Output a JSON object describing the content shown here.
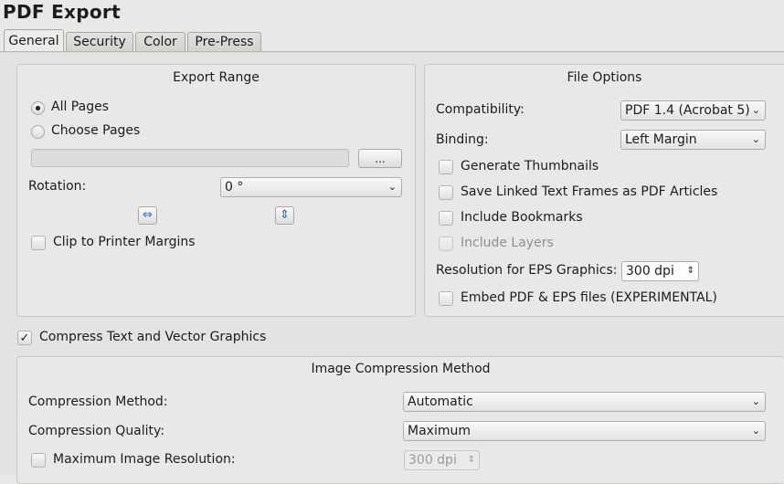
{
  "window": {
    "title": "PDF Export"
  },
  "tabs": [
    {
      "label": "General"
    },
    {
      "label": "Security"
    },
    {
      "label": "Color"
    },
    {
      "label": "Pre-Press"
    }
  ],
  "export_range": {
    "title": "Export Range",
    "all_pages": "All Pages",
    "choose_pages": "Choose Pages",
    "pages_value": "",
    "browse_label": "...",
    "rotation_label": "Rotation:",
    "rotation_value": "0 °",
    "clip_label": "Clip to Printer Margins"
  },
  "file_options": {
    "title": "File Options",
    "compatibility_label": "Compatibility:",
    "compatibility_value": "PDF 1.4 (Acrobat 5)",
    "binding_label": "Binding:",
    "binding_value": "Left Margin",
    "generate_thumbnails": "Generate Thumbnails",
    "save_linked": "Save Linked Text Frames as PDF Articles",
    "include_bookmarks": "Include Bookmarks",
    "include_layers": "Include Layers",
    "resolution_label": "Resolution for EPS Graphics:",
    "resolution_value": "300 dpi",
    "embed_label": "Embed PDF & EPS files (EXPERIMENTAL)"
  },
  "compress_text": "Compress Text and Vector Graphics",
  "image_compression": {
    "title": "Image Compression Method",
    "method_label": "Compression Method:",
    "method_value": "Automatic",
    "quality_label": "Compression Quality:",
    "quality_value": "Maximum",
    "max_res_label": "Maximum Image Resolution:",
    "max_res_value": "300 dpi"
  },
  "icons": {
    "check": "✓",
    "chevron": "⌄",
    "spin": "⇕",
    "flip_h": "⇔",
    "flip_v": "⇕"
  }
}
